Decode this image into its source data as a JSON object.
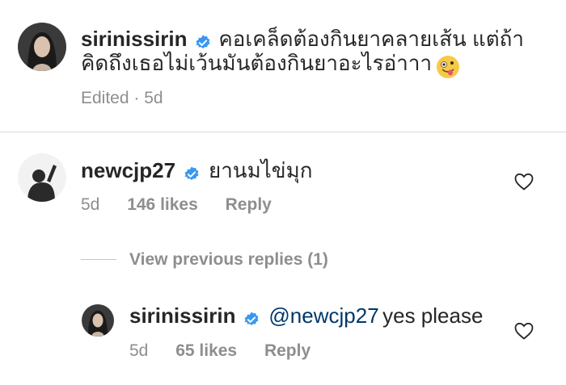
{
  "caption": {
    "username": "sirinissirin",
    "text_line1": "คอเคล็ดต้องกินยาคลายเส้น แต่ถ้า",
    "text_line2": "คิดถึงเธอไม่เว้นมันต้องกินยาอะไรอ่าาา",
    "emoji": "🤪",
    "edited": "Edited · 5d"
  },
  "comment": {
    "username": "newcjp27",
    "text": "ยานมไข่มุก",
    "time": "5d",
    "likes": "146 likes",
    "reply": "Reply"
  },
  "view_replies": "View previous replies (1)",
  "reply": {
    "username": "sirinissirin",
    "mention": "@newcjp27",
    "text": "yes please",
    "time": "5d",
    "likes": "65 likes",
    "reply": "Reply"
  },
  "colors": {
    "verified": "#3897f0",
    "mention": "#00376b",
    "meta": "#8e8e8e"
  },
  "icons": [
    "verified-badge-icon",
    "heart-icon",
    "crazy-face-emoji-icon"
  ]
}
